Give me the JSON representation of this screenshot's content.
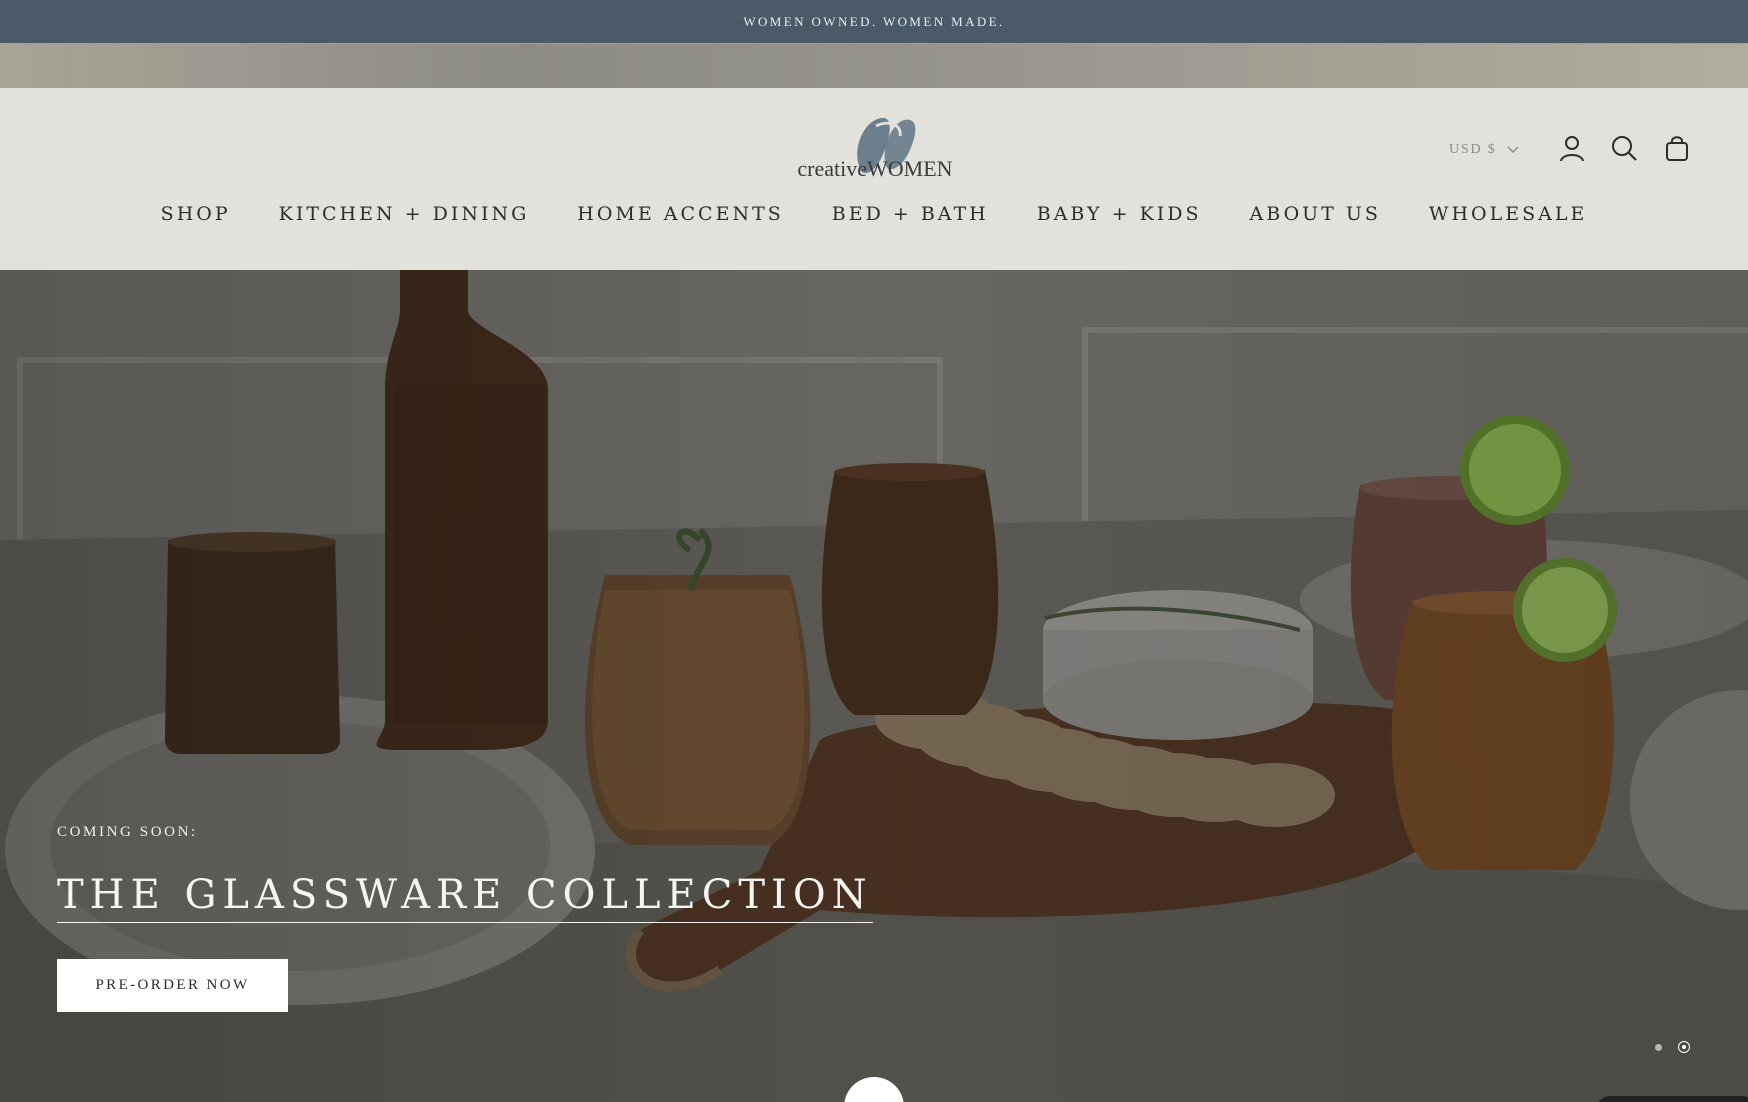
{
  "announcement": {
    "text": "WOMEN OWNED. WOMEN MADE."
  },
  "header": {
    "logo": {
      "text": "creativeWOMEN",
      "mark_color": "#5e7484"
    },
    "currency": {
      "label": "USD $"
    },
    "icons": [
      "account-icon",
      "search-icon",
      "cart-icon"
    ]
  },
  "nav": {
    "items": [
      {
        "label": "SHOP"
      },
      {
        "label": "KITCHEN + DINING"
      },
      {
        "label": "HOME ACCENTS"
      },
      {
        "label": "BED + BATH"
      },
      {
        "label": "BABY + KIDS"
      },
      {
        "label": "ABOUT US"
      },
      {
        "label": "WHOLESALE"
      }
    ]
  },
  "hero": {
    "eyebrow": "COMING SOON:",
    "headline": "THE GLASSWARE COLLECTION",
    "cta_label": "PRE-ORDER NOW",
    "slides": {
      "count": 2,
      "active": 2
    }
  },
  "colors": {
    "announcement_bg": "#4a5a69",
    "header_bg": "#e2e1dc",
    "text_dark": "#2d2d2d",
    "glass_amber": "#8a5a30",
    "glass_pink": "#c48a7a",
    "board_wood": "#6e4426"
  }
}
